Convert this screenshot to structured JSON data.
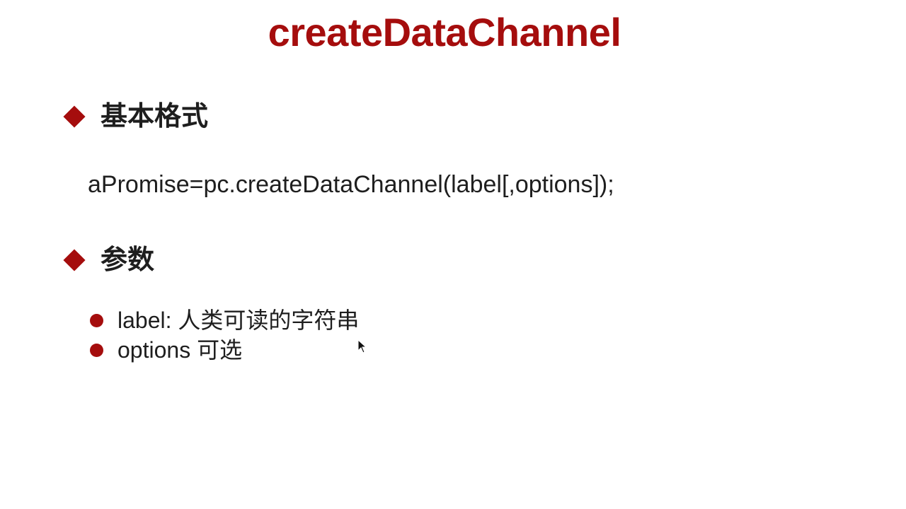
{
  "slide": {
    "title": "createDataChannel"
  },
  "sections": [
    {
      "heading": "基本格式",
      "code": "aPromise=pc.createDataChannel(label[,options]);"
    },
    {
      "heading": "参数",
      "items": [
        "label: 人类可读的字符串",
        "options 可选"
      ]
    }
  ],
  "colors": {
    "accent": "#a50d0d",
    "text": "#1e1e1e",
    "background": "#ffffff"
  },
  "icons": {
    "section_bullet": "diamond-icon",
    "list_bullet": "dot-icon",
    "pointer": "mouse-cursor-icon"
  }
}
